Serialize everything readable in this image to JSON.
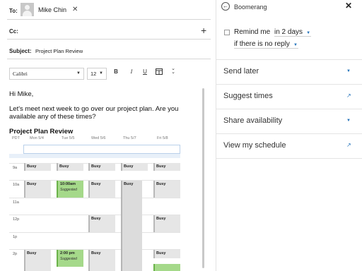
{
  "compose": {
    "to_label": "To:",
    "recipient": "Mike Chin",
    "cc_label": "Cc:",
    "subject_label": "Subject:",
    "subject": "Project Plan Review",
    "font_name": "Calibri",
    "font_size": "12",
    "toolbar": {
      "bold": "B",
      "italic": "I",
      "underline": "U",
      "more": "⌄⌄"
    },
    "body": {
      "greeting": "Hi Mike,",
      "line1": "Let's meet next week to go over our project plan. Are you",
      "line2": "available any of these times?",
      "plan_title": "Project Plan Review"
    },
    "calendar": {
      "tz": "PDT",
      "days": [
        "Mon 5/4",
        "Tue 5/5",
        "Wed 5/6",
        "Thu 5/7",
        "Fri 5/8"
      ],
      "times": [
        "9a",
        "10a",
        "11a",
        "12p",
        "1p",
        "2p"
      ],
      "busy_label": "Busy",
      "suggested_label": "Suggested",
      "suggestions": [
        "10:00am",
        "2:00 pm"
      ]
    }
  },
  "pane": {
    "title": "Boomerang",
    "remind_text": "Remind me",
    "remind_when": "in 2 days",
    "remind_condition": "if there is no reply",
    "options": [
      "Send later",
      "Suggest times",
      "Share availability",
      "View my schedule"
    ],
    "option_icons": [
      "caret-down",
      "external-arrow",
      "caret-down",
      "external-arrow"
    ],
    "accent_color": "#2372ba"
  }
}
